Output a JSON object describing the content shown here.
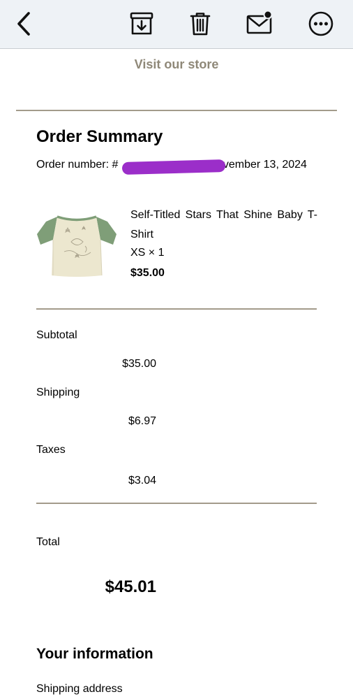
{
  "toolbar": {
    "back_icon": "chevron-left-icon",
    "archive_icon": "archive-download-icon",
    "delete_icon": "trash-icon",
    "mark_unread_icon": "mail-unread-icon",
    "more_icon": "more-horizontal-icon"
  },
  "email": {
    "visit_store_link": "Visit our store",
    "order_summary": {
      "heading": "Order Summary",
      "order_number_prefix": "Order number: #",
      "order_date_suffix": "November 13, 2024",
      "item": {
        "title": "Self-Titled Stars That Shine Baby T-Shirt",
        "variant": "XS × 1",
        "price": "$35.00"
      },
      "subtotal_label": "Subtotal",
      "subtotal_value": "$35.00",
      "shipping_label": "Shipping",
      "shipping_value": "$6.97",
      "taxes_label": "Taxes",
      "taxes_value": "$3.04",
      "total_label": "Total",
      "total_value": "$45.01"
    },
    "your_information": {
      "heading": "Your information",
      "shipping_address_label": "Shipping address"
    }
  },
  "colors": {
    "toolbar_bg": "#eef2f6",
    "link_text": "#8f8878",
    "divider": "#a39b8b",
    "redaction": "#9b2ec9",
    "shirt_body": "#ece7cf",
    "shirt_sleeves": "#7f9e78"
  }
}
